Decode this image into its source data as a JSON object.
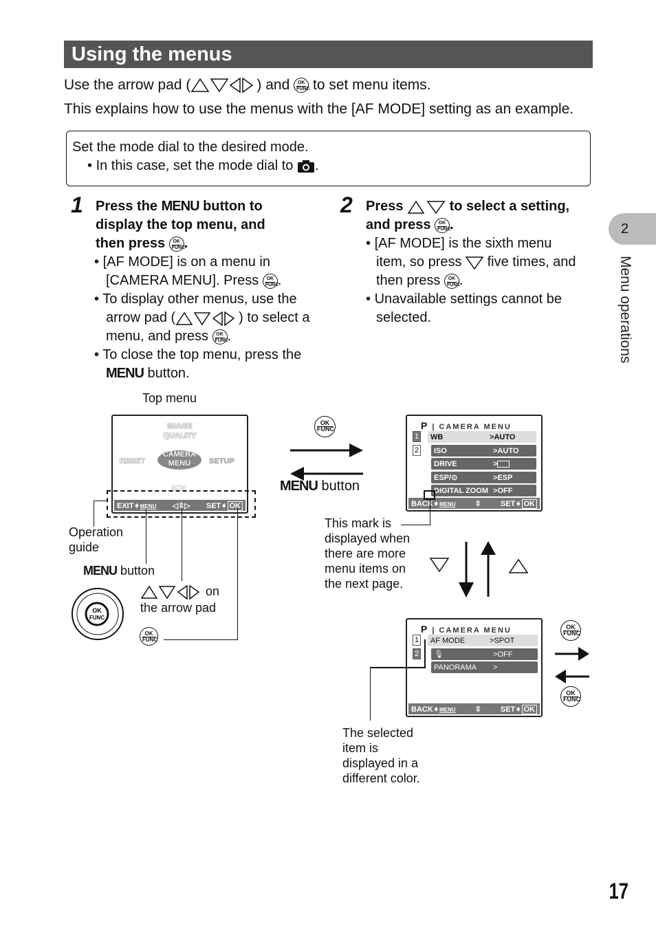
{
  "title": "Using the menus",
  "intro": {
    "line1a": "Use the arrow pad (",
    "line1b": ") and",
    "line1c": "to set menu items.",
    "line2": "This explains how to use the menus with the [AF MODE] setting as an example."
  },
  "box": {
    "line1": "Set the mode dial to the desired mode.",
    "line2": "In this case, set the mode dial to",
    "icon": "camera-icon"
  },
  "step1": {
    "num": "1",
    "h1a": "Press the",
    "h1menu": "MENU",
    "h1b": "button to",
    "h2": "display the top menu, and",
    "h3": "then press",
    "b1a": "[AF MODE] is on a menu in",
    "b1b": "[CAMERA MENU]. Press",
    "b2a": "To display other menus, use the",
    "b2b": "arrow pad (",
    "b2c": ") to select a",
    "b2d": "menu, and press",
    "b3a": "To close the top menu, press the",
    "b3menu": "MENU",
    "b3b": "button."
  },
  "step2": {
    "num": "2",
    "h1a": "Press",
    "h1b": "to select a setting,",
    "h2": "and press",
    "b1a": "[AF MODE] is the sixth menu",
    "b1b": "item, so press",
    "b1c": "five times, and",
    "b1d": "then press",
    "b2a": "Unavailable settings cannot be",
    "b2b": "selected."
  },
  "top_menu": {
    "label": "Top menu",
    "items": [
      "IMAGE QUALITY",
      "RESET",
      "CAMERA MENU",
      "SETUP",
      "SCN"
    ],
    "exit": "EXIT",
    "menu": "MENU",
    "set": "SET",
    "ok": "OK"
  },
  "labels": {
    "op_guide1": "Operation",
    "op_guide2": "guide",
    "menu_btn": "MENU",
    "button": "button",
    "arrow_on": "on",
    "arrow_pad": "the arrow pad",
    "mark1": "This mark is",
    "mark2": "displayed when",
    "mark3": "there are more",
    "mark4": "menu items on",
    "mark5": "the next page.",
    "sel1": "The selected",
    "sel2": "item is",
    "sel3": "displayed in a",
    "sel4": "different color."
  },
  "ok_func": {
    "ok": "OK",
    "func": "FUNC"
  },
  "camera_menu1": {
    "mode": "P",
    "title": "CAMERA MENU",
    "pages": [
      "1",
      "2"
    ],
    "rows": [
      {
        "k": "WB",
        "v": "AUTO"
      },
      {
        "k": "ISO",
        "v": "AUTO"
      },
      {
        "k": "DRIVE",
        "v": ""
      },
      {
        "k": "ESP/",
        "v": "ESP"
      },
      {
        "k": "DIGITAL ZOOM",
        "v": "OFF"
      }
    ],
    "back": "BACK",
    "menu": "MENU",
    "set": "SET",
    "ok": "OK"
  },
  "camera_menu2": {
    "mode": "P",
    "title": "CAMERA MENU",
    "pages": [
      "1",
      "2"
    ],
    "rows": [
      {
        "k": "AF MODE",
        "v": "SPOT"
      },
      {
        "k": "",
        "v": "OFF"
      },
      {
        "k": "PANORAMA",
        "v": ""
      }
    ],
    "back": "BACK",
    "menu": "MENU",
    "set": "SET",
    "ok": "OK"
  },
  "side_tab": {
    "num": "2",
    "label": "Menu operations"
  },
  "page_number": "17"
}
